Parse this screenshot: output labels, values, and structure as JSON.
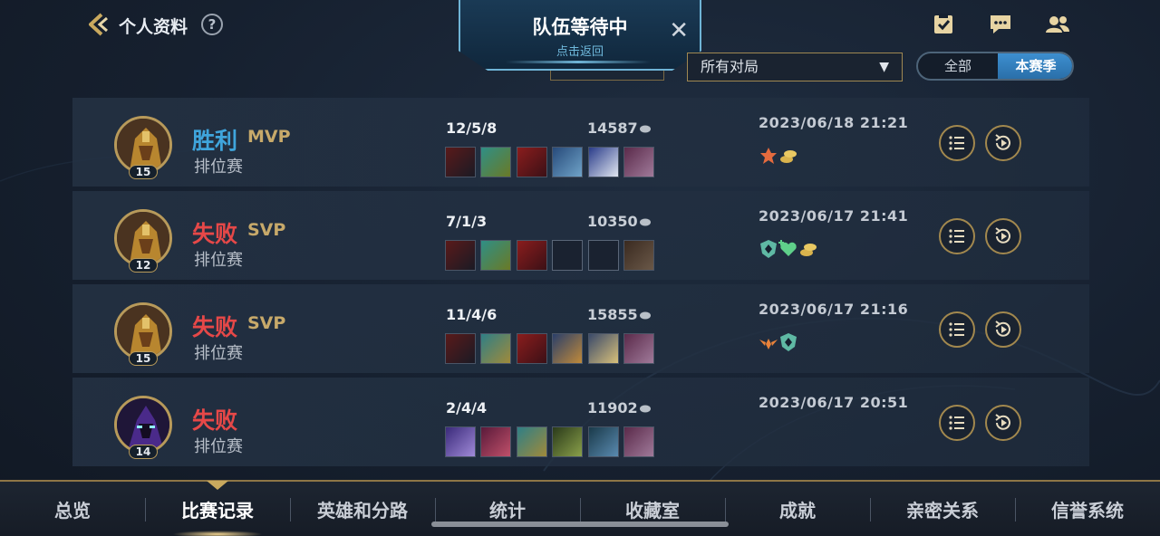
{
  "header": {
    "title": "个人资料",
    "help": "?"
  },
  "queue": {
    "title": "队伍等待中",
    "subtitle": "点击返回"
  },
  "filter": {
    "selected": "所有对局"
  },
  "season_toggle": {
    "all": "全部",
    "current": "本赛季",
    "active": "本赛季"
  },
  "matches": [
    {
      "result": "胜利",
      "badge": "MVP",
      "mode": "排位赛",
      "level": "15",
      "kda": "12/5/8",
      "gold": "14587",
      "date": "2023/06/18 21:21"
    },
    {
      "result": "失败",
      "badge": "SVP",
      "mode": "排位赛",
      "level": "12",
      "kda": "7/1/3",
      "gold": "10350",
      "date": "2023/06/17 21:41"
    },
    {
      "result": "失败",
      "badge": "SVP",
      "mode": "排位赛",
      "level": "15",
      "kda": "11/4/6",
      "gold": "15855",
      "date": "2023/06/17 21:16"
    },
    {
      "result": "失败",
      "badge": "",
      "mode": "排位赛",
      "level": "14",
      "kda": "2/4/4",
      "gold": "11902",
      "date": "2023/06/17 20:51"
    }
  ],
  "nav": {
    "items": [
      "总览",
      "比赛记录",
      "英雄和分路",
      "统计",
      "收藏室",
      "成就",
      "亲密关系",
      "信誉系统"
    ],
    "active": "比赛记录"
  },
  "colors": {
    "win": "#3fa5dc",
    "loss": "#e64848",
    "gold_accent": "#b89a5a",
    "season_active": "#3d8fd0"
  }
}
